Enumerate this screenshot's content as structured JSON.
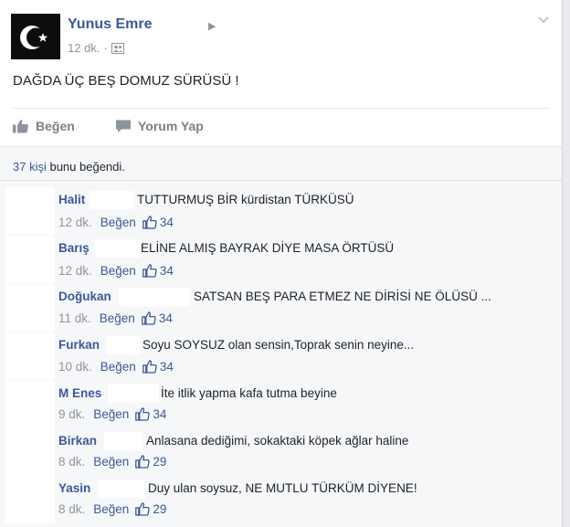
{
  "post": {
    "author": "Yunus Emre",
    "time": "12 dk.",
    "dot": "·",
    "text": "DAĞDA ÜÇ BEŞ DOMUZ SÜRÜSÜ !",
    "audience_icon": "friends-icon"
  },
  "actions": {
    "like_label": "Beğen",
    "comment_label": "Yorum Yap"
  },
  "likes_summary": {
    "count_link": "37 kişi",
    "rest": " bunu beğendi."
  },
  "comment_like_label": "Beğen",
  "comments": [
    {
      "author": "Halit",
      "text": "TUTTURMUŞ BİR kürdistan TÜRKÜSÜ",
      "time": "12 dk.",
      "likes": "34"
    },
    {
      "author": "Barış",
      "text": "ELİNE ALMIŞ BAYRAK DİYE MASA ÖRTÜSÜ",
      "time": "12 dk.",
      "likes": "34"
    },
    {
      "author": "Doğukan",
      "text": "SATSAN BEŞ PARA ETMEZ NE DİRİSİ NE ÖLÜSÜ ...",
      "time": "11 dk.",
      "likes": "34"
    },
    {
      "author": "Furkan",
      "text": "Soyu SOYSUZ olan sensin,Toprak senin neyine...",
      "time": "10 dk.",
      "likes": "34"
    },
    {
      "author": "M Enes",
      "text": "İte itlik yapma kafa tutma beyine",
      "time": "9 dk.",
      "likes": "34"
    },
    {
      "author": "Birkan",
      "text": "Anlasana dediğimi, sokaktaki köpek ağlar haline",
      "time": "8 dk.",
      "likes": "29"
    },
    {
      "author": "Yasin",
      "text": "Duy ulan soysuz, NE MUTLU TÜRKÜM DİYENE!",
      "time": "8 dk.",
      "likes": "29"
    }
  ],
  "colors": {
    "link": "#3b5998",
    "meta": "#90949c",
    "text": "#1d2129",
    "comment_bg": "#f6f7f9"
  }
}
